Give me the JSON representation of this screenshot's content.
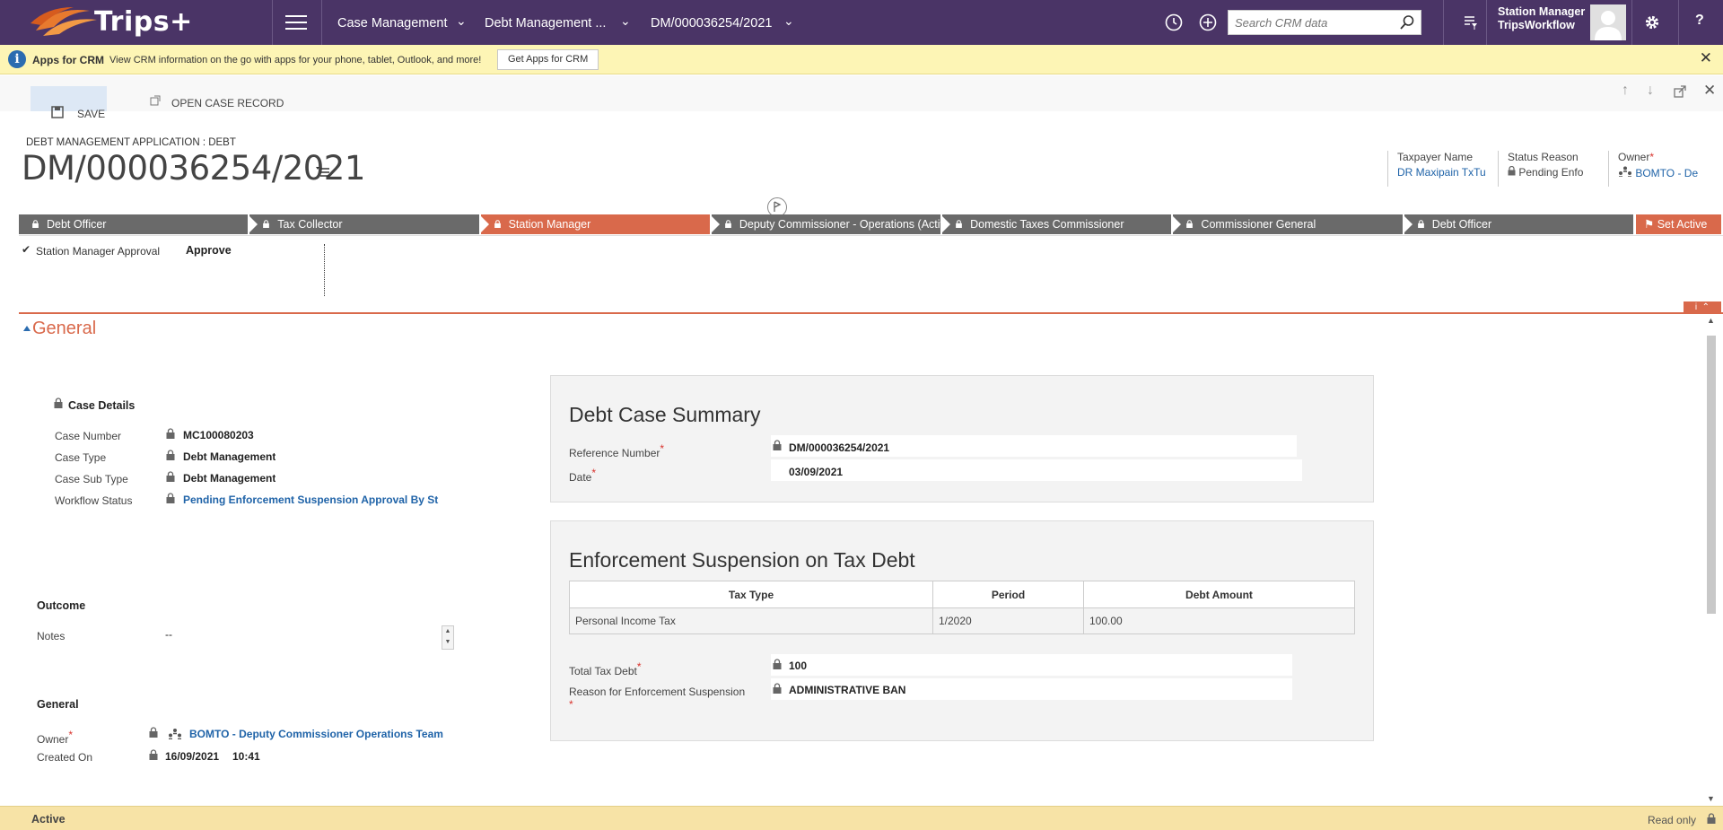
{
  "app": {
    "logo_text": "Trips+",
    "nav": {
      "module": "Case Management",
      "area": "Debt Management ...",
      "record": "DM/000036254/2021"
    },
    "search": {
      "placeholder": "Search CRM data"
    },
    "user": {
      "role": "Station Manager",
      "org": "TripsWorkflow"
    },
    "help": "?"
  },
  "banner": {
    "title": "Apps for CRM",
    "message": "View CRM information on the go with apps for your phone, tablet, Outlook, and more!",
    "button": "Get Apps for CRM"
  },
  "commands": {
    "save": "SAVE",
    "open_case": "OPEN CASE RECORD"
  },
  "header": {
    "entity_type": "DEBT MANAGEMENT APPLICATION : DEBT",
    "title": "DM/000036254/2021",
    "fields": [
      {
        "label": "Taxpayer Name",
        "value": "DR Maxipain TxTu"
      },
      {
        "label": "Status Reason",
        "value": "Pending Enfo"
      },
      {
        "label": "Owner",
        "value": "BOMTO - De"
      }
    ]
  },
  "process": {
    "stages": [
      "Debt Officer",
      "Tax Collector",
      "Station Manager",
      "Deputy Commissioner - Operations (Active)",
      "Domestic Taxes Commissioner",
      "Commissioner General",
      "Debt Officer"
    ],
    "active_index": 2,
    "set_active": "Set Active",
    "step_label": "Station Manager Approval",
    "step_value": "Approve"
  },
  "section": {
    "title": "General"
  },
  "case_details": {
    "title": "Case Details",
    "fields": [
      {
        "label": "Case Number",
        "value": "MC100080203"
      },
      {
        "label": "Case Type",
        "value": "Debt Management"
      },
      {
        "label": "Case Sub Type",
        "value": "Debt Management"
      },
      {
        "label": "Workflow Status",
        "value": "Pending Enforcement Suspension Approval By St..."
      }
    ]
  },
  "outcome": {
    "title": "Outcome",
    "notes_label": "Notes",
    "notes_value": "--"
  },
  "general_group": {
    "title": "General",
    "owner_label": "Owner",
    "owner_value": "BOMTO - Deputy Commissioner Operations Team",
    "created_label": "Created On",
    "created_date": "16/09/2021",
    "created_time": "10:41"
  },
  "summary": {
    "title": "Debt Case Summary",
    "ref_label": "Reference Number",
    "ref_value": "DM/000036254/2021",
    "date_label": "Date",
    "date_value": "03/09/2021"
  },
  "suspension": {
    "title": "Enforcement Suspension on Tax Debt",
    "columns": [
      "Tax Type",
      "Period",
      "Debt Amount"
    ],
    "rows": [
      [
        "Personal Income Tax",
        "1/2020",
        "100.00"
      ]
    ],
    "total_label": "Total Tax Debt",
    "total_value": "100",
    "reason_label": "Reason for Enforcement Suspension",
    "reason_value": "ADMINISTRATIVE BAN"
  },
  "footer": {
    "status": "Active",
    "mode": "Read only"
  },
  "colors": {
    "nav_bg": "#4a3466",
    "accent": "#d9694b",
    "link": "#1f63a8",
    "banner_bg": "#fdf5b5",
    "footer_bg": "#f7e3a6"
  }
}
